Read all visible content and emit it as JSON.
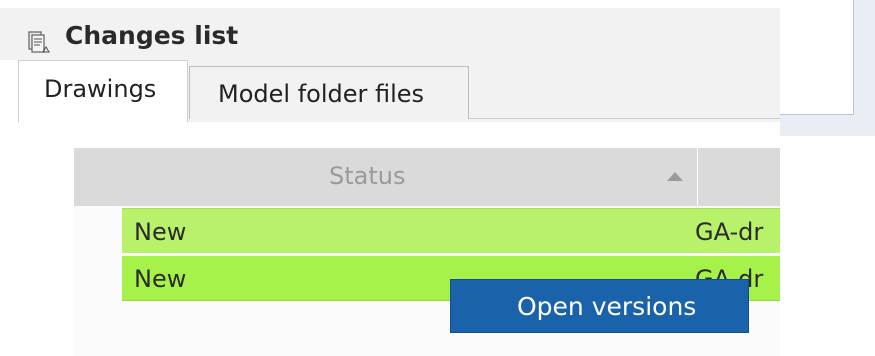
{
  "panel": {
    "title": "Changes list",
    "title_icon": "document-list-icon"
  },
  "tabs": [
    {
      "label": "Drawings",
      "active": true
    },
    {
      "label": "Model folder files",
      "active": false
    }
  ],
  "table": {
    "columns": [
      {
        "label": "Status",
        "sort": "ascending"
      },
      {
        "label": ""
      }
    ],
    "rows": [
      {
        "status": "New",
        "name": "GA-dr",
        "color": "#b8f26a"
      },
      {
        "status": "New",
        "name": "GA-dr",
        "color": "#a7f24a"
      }
    ]
  },
  "context_menu": {
    "items": [
      {
        "label": "Open versions",
        "highlighted": true
      }
    ],
    "highlight_color": "#1a63aa"
  }
}
